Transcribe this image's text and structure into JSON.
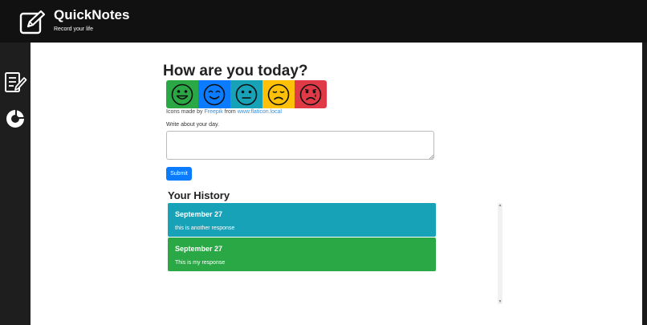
{
  "header": {
    "title": "QuickNotes",
    "subtitle": "Record your life"
  },
  "sidebar": {
    "items": [
      {
        "icon": "journal-icon"
      },
      {
        "icon": "stats-icon"
      }
    ]
  },
  "main": {
    "question": "How are you today?",
    "moods": [
      {
        "name": "very-happy",
        "color": "#2aa845"
      },
      {
        "name": "happy",
        "color": "#0b7bff"
      },
      {
        "name": "neutral",
        "color": "#17a2b8"
      },
      {
        "name": "sad",
        "color": "#ffc107"
      },
      {
        "name": "very-sad",
        "color": "#e03a47"
      }
    ],
    "credit": {
      "prefix": "Icons made by ",
      "author": "Freepik",
      "middle": " from ",
      "site": "www.flaticon.local"
    },
    "write_label": "Write about your day.",
    "journal_value": "",
    "submit_label": "Submit",
    "history_title": "Your History",
    "history": [
      {
        "date": "September 27",
        "text": "this is another response",
        "color": "#17a2b8"
      },
      {
        "date": "September 27",
        "text": "This is my response",
        "color": "#2aa845"
      }
    ]
  }
}
